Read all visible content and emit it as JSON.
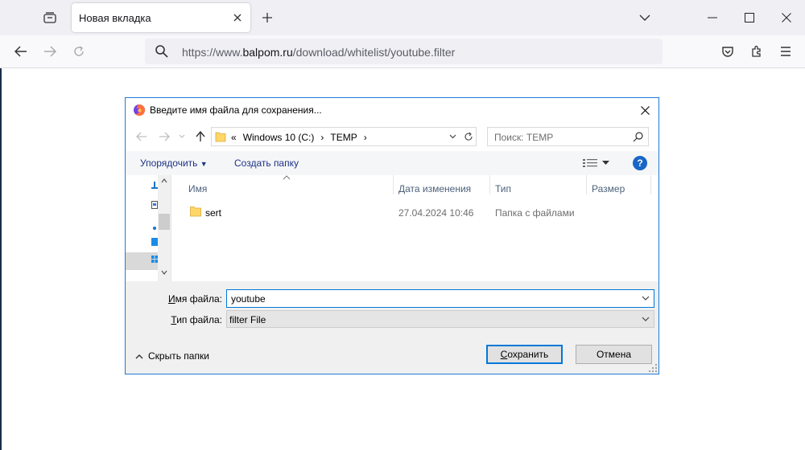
{
  "browser": {
    "tab": {
      "title": "Новая вкладка"
    },
    "url": {
      "prefix": "https://www.",
      "host": "balpom.ru",
      "path": "/download/whitelist/youtube.filter"
    }
  },
  "dialog": {
    "title": "Введите имя файла для сохранения...",
    "address": {
      "ellipsis": "«",
      "crumbs": [
        "Windows 10 (C:)",
        "TEMP"
      ]
    },
    "search_placeholder": "Поиск: TEMP",
    "toolbar": {
      "organize": "Упорядочить",
      "new_folder": "Создать папку"
    },
    "columns": [
      "Имя",
      "Дата изменения",
      "Тип",
      "Размер"
    ],
    "files": [
      {
        "name": "sert",
        "date": "27.04.2024 10:46",
        "type": "Папка с файлами",
        "size": ""
      }
    ],
    "filename_label_prefix": "И",
    "filename_label_rest": "мя файла:",
    "filetype_label_prefix": "Т",
    "filetype_label_rest": "ип файла:",
    "filename_value": "youtube",
    "filetype_value": "filter File",
    "hide_folders": "Скрыть папки",
    "save_prefix": "С",
    "save_rest": "охранить",
    "cancel": "Отмена"
  },
  "colors": {
    "dialog_border": "#1f7ad8",
    "help": "#1866c6",
    "focus": "#0078d7",
    "link": "#1e3287"
  },
  "icons": [
    "tab-list-icon",
    "close-icon",
    "plus-icon",
    "chevron-down-icon",
    "minimize-icon",
    "maximize-icon",
    "back-icon",
    "forward-icon",
    "reload-icon",
    "search-icon",
    "pocket-icon",
    "extensions-icon",
    "menu-icon",
    "firefox-icon",
    "folder-icon",
    "up-icon",
    "view-icon",
    "help-icon"
  ]
}
